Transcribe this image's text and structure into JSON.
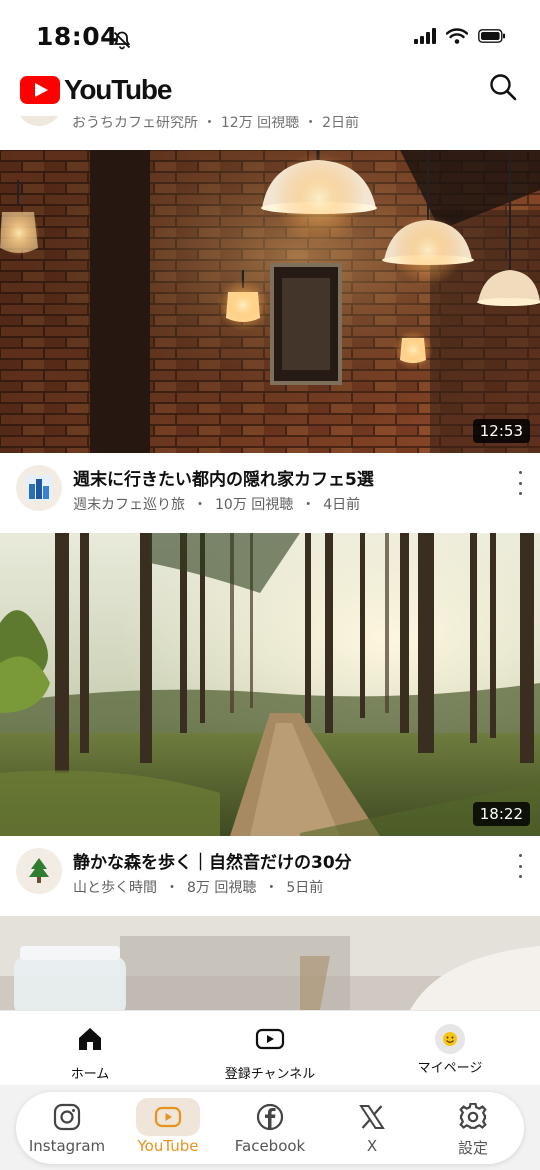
{
  "status_bar": {
    "time": "18:04"
  },
  "header": {
    "brand": "YouTube"
  },
  "partial_video": {
    "meta": "おうちカフェ研究所 ・ 12万 回視聴 ・ 2日前"
  },
  "videos": [
    {
      "duration": "12:53",
      "title": "週末に行きたい都内の隠れ家カフェ5選",
      "channel": "週末カフェ巡り旅",
      "views": "10万 回視聴",
      "age": "4日前"
    },
    {
      "duration": "18:22",
      "title": "静かな森を歩く｜自然音だけの30分",
      "channel": "山と歩く時間",
      "views": "8万 回視聴",
      "age": "5日前"
    }
  ],
  "yt_nav": {
    "home": "ホーム",
    "subscriptions": "登録チャンネル",
    "mypage": "マイページ"
  },
  "app_bar": {
    "tabs": [
      "Instagram",
      "YouTube",
      "Facebook",
      "X",
      "設定"
    ],
    "active": "YouTube",
    "active_color": "#e8931f"
  }
}
